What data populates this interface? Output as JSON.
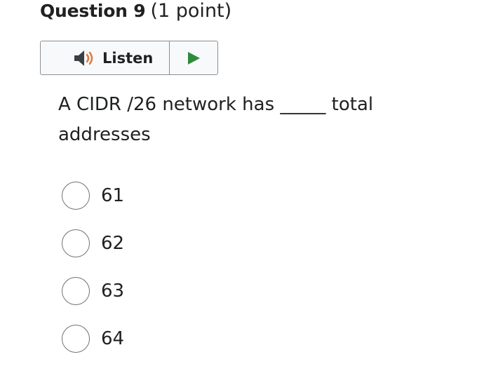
{
  "question": {
    "number_label": "Question 9",
    "points_label": "(1 point)",
    "text": "A CIDR /26 network has _____ total addresses"
  },
  "listen": {
    "label": "Listen",
    "speaker_icon": "speaker-icon",
    "play_icon": "play-icon",
    "play_color": "#2e8b3e",
    "speaker_color": "#3a3f44",
    "sound_wave_color": "#e07a3a"
  },
  "options": [
    {
      "label": "61"
    },
    {
      "label": "62"
    },
    {
      "label": "63"
    },
    {
      "label": "64"
    }
  ]
}
